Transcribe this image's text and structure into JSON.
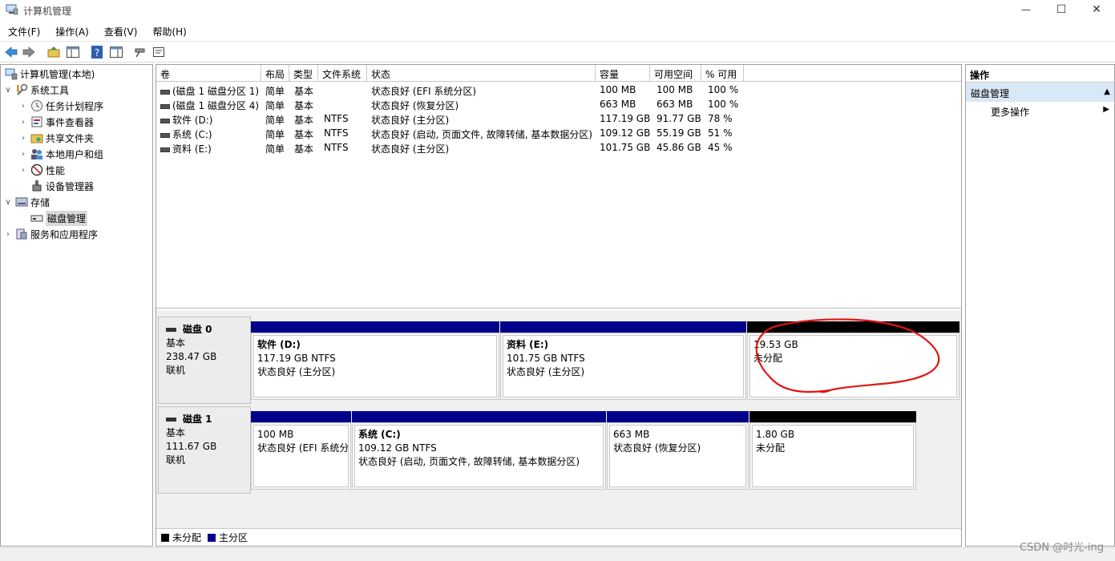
{
  "window": {
    "title": "计算机管理",
    "minimize_glyph": "—",
    "maximize_glyph": "☐",
    "close_glyph": "✕"
  },
  "menu": [
    "文件(F)",
    "操作(A)",
    "查看(V)",
    "帮助(H)"
  ],
  "toolbar_icons": [
    "back-icon",
    "forward-icon",
    "up-folder-icon",
    "show-hide-console-tree-icon",
    "help-icon",
    "properties-icon",
    "connect-icon",
    "settings-icon"
  ],
  "tree": {
    "root": "计算机管理(本地)",
    "system_tools": "系统工具",
    "task_scheduler": "任务计划程序",
    "event_viewer": "事件查看器",
    "shared_folders": "共享文件夹",
    "local_users": "本地用户和组",
    "performance": "性能",
    "device_manager": "设备管理器",
    "storage": "存储",
    "disk_management": "磁盘管理",
    "services_apps": "服务和应用程序"
  },
  "volumes": {
    "columns": [
      "卷",
      "布局",
      "类型",
      "文件系统",
      "状态",
      "容量",
      "可用空间",
      "% 可用"
    ],
    "rows": [
      [
        "(磁盘 1 磁盘分区 1)",
        "简单",
        "基本",
        "",
        "状态良好 (EFI 系统分区)",
        "100 MB",
        "100 MB",
        "100 %"
      ],
      [
        "(磁盘 1 磁盘分区 4)",
        "简单",
        "基本",
        "",
        "状态良好 (恢复分区)",
        "663 MB",
        "663 MB",
        "100 %"
      ],
      [
        "软件 (D:)",
        "简单",
        "基本",
        "NTFS",
        "状态良好 (主分区)",
        "117.19 GB",
        "91.77 GB",
        "78 %"
      ],
      [
        "系统 (C:)",
        "简单",
        "基本",
        "NTFS",
        "状态良好 (启动, 页面文件, 故障转储, 基本数据分区)",
        "109.12 GB",
        "55.19 GB",
        "51 %"
      ],
      [
        "资料 (E:)",
        "简单",
        "基本",
        "NTFS",
        "状态良好 (主分区)",
        "101.75 GB",
        "45.86 GB",
        "45 %"
      ]
    ]
  },
  "disks": [
    {
      "name": "磁盘 0",
      "type": "基本",
      "size": "238.47 GB",
      "status": "联机",
      "partitions": [
        {
          "title": "软件   (D:)",
          "size": "117.19 GB NTFS",
          "status": "状态良好 (主分区)",
          "kind": "primary"
        },
        {
          "title": "资料   (E:)",
          "size": "101.75 GB NTFS",
          "status": "状态良好 (主分区)",
          "kind": "primary"
        },
        {
          "title": "",
          "size": "19.53 GB",
          "status": "未分配",
          "kind": "unallocated"
        }
      ]
    },
    {
      "name": "磁盘 1",
      "type": "基本",
      "size": "111.67 GB",
      "status": "联机",
      "partitions": [
        {
          "title": "",
          "size": "100 MB",
          "status": "状态良好 (EFI 系统分",
          "kind": "primary"
        },
        {
          "title": "系统   (C:)",
          "size": "109.12 GB NTFS",
          "status": "状态良好 (启动, 页面文件, 故障转储, 基本数据分区)",
          "kind": "primary"
        },
        {
          "title": "",
          "size": "663 MB",
          "status": "状态良好 (恢复分区)",
          "kind": "primary"
        },
        {
          "title": "",
          "size": "1.80 GB",
          "status": "未分配",
          "kind": "unallocated"
        }
      ]
    }
  ],
  "legend": {
    "unallocated": "未分配",
    "primary": "主分区"
  },
  "colors": {
    "primary": "#00008b",
    "unallocated": "#000000",
    "annotation": "#e31414",
    "selected_action": "#d9e8f6"
  },
  "actions": {
    "title": "操作",
    "section": "磁盘管理",
    "more": "更多操作"
  },
  "watermark": "CSDN @时光-ing"
}
